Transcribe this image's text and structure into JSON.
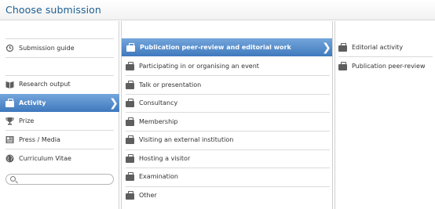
{
  "header": {
    "title": "Choose submission"
  },
  "left_column": {
    "items": [
      {
        "label": "Submission guide",
        "icon": "history-icon"
      },
      {
        "label": "Research output",
        "icon": "book-icon"
      },
      {
        "label": "Activity",
        "icon": "briefcase-icon",
        "selected": true
      },
      {
        "label": "Prize",
        "icon": "trophy-icon"
      },
      {
        "label": "Press / Media",
        "icon": "newspaper-icon"
      },
      {
        "label": "Curriculum Vitae",
        "icon": "globe-icon"
      }
    ],
    "search": {
      "placeholder": ""
    }
  },
  "middle_column": {
    "items": [
      {
        "label": "Publication peer-review and editorial work",
        "selected": true
      },
      {
        "label": "Participating in or organising an event"
      },
      {
        "label": "Talk or presentation"
      },
      {
        "label": "Consultancy"
      },
      {
        "label": "Membership"
      },
      {
        "label": "Visiting an external institution"
      },
      {
        "label": "Hosting a visitor"
      },
      {
        "label": "Examination"
      },
      {
        "label": "Other"
      }
    ]
  },
  "right_column": {
    "items": [
      {
        "label": "Editorial activity"
      },
      {
        "label": "Publication peer-review"
      }
    ]
  },
  "colors": {
    "title": "#1d5f93",
    "selected_top": "#74a6dc",
    "selected_bottom": "#3f79bd",
    "icon": "#5e5e5e"
  }
}
